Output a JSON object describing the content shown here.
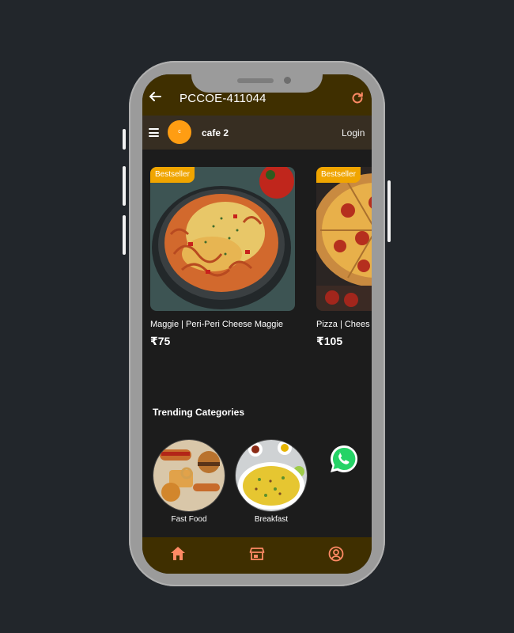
{
  "app": {
    "location_title": "PCCOE-411044",
    "cafe_name": "cafe 2",
    "avatar_letter": "c",
    "login_label": "Login"
  },
  "products": [
    {
      "badge": "Bestseller",
      "name": "Maggie | Peri-Peri Cheese Maggie",
      "price": "₹75"
    },
    {
      "badge": "Bestseller",
      "name": "Pizza | Chees",
      "price": "₹105"
    }
  ],
  "trending": {
    "title": "Trending Categories",
    "categories": [
      {
        "label": "Fast Food"
      },
      {
        "label": "Breakfast"
      }
    ]
  },
  "icons": {
    "back": "arrow-left-icon",
    "refresh": "refresh-icon",
    "menu": "hamburger-menu-icon",
    "whatsapp": "whatsapp-icon",
    "nav_home": "home-icon",
    "nav_store": "store-icon",
    "nav_profile": "account-circle-icon"
  },
  "colors": {
    "topbar": "#3f2f00",
    "header": "#372e22",
    "badge": "#f0a500",
    "avatar": "#ff9d12",
    "accent_icon": "#ff8a65",
    "background": "#1c1c1c"
  }
}
